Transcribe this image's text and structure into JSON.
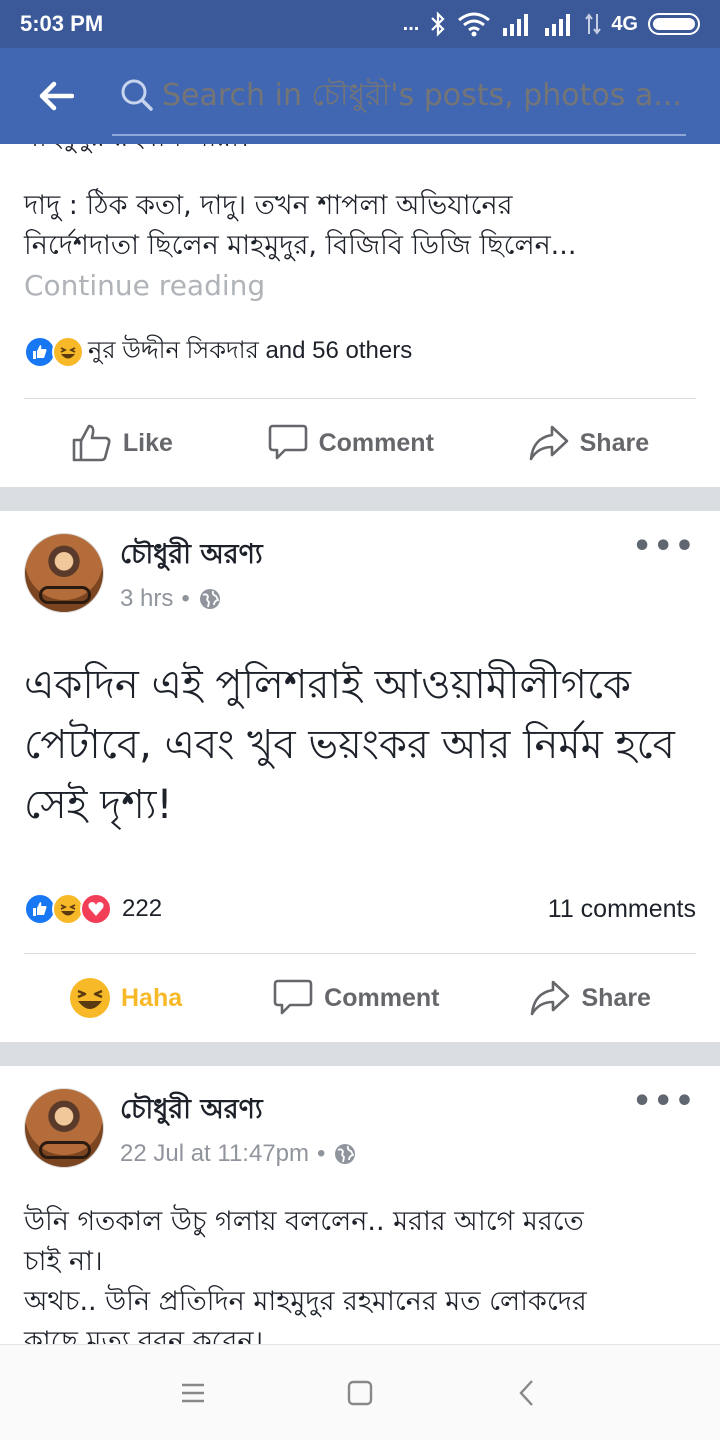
{
  "status_bar": {
    "time": "5:03 PM",
    "dots": "...",
    "network": "4G"
  },
  "app_bar": {
    "search_placeholder": "Search in চৌধুরী's posts, photos a..."
  },
  "post_prev": {
    "cut_line": "মাহমুদুর রহমান পারা।",
    "text_lines": [
      "দাদু : ঠিক কতা, দাদু। তখন শাপলা অভিযানের",
      "নির্দেশদাতা ছিলেন মাহমুদুর, বিজিবি ডিজি ছিলেন..."
    ],
    "continue_label": "Continue reading",
    "reactions_text": "নুর উদ্দীন সিকদার and 56 others",
    "actions": {
      "like": "Like",
      "comment": "Comment",
      "share": "Share"
    }
  },
  "post_main": {
    "author": "চৌধুরী অরণ্য",
    "time": "3 hrs",
    "text": "একদিন এই পুলিশরাই আওয়ামীলীগকে পেটাবে, এবং খুব ভয়ংকর আর নির্মম হবে সেই দৃশ্য!",
    "reaction_count": "222",
    "comments": "11 comments",
    "actions": {
      "haha": "Haha",
      "comment": "Comment",
      "share": "Share"
    }
  },
  "post_next": {
    "author": "চৌধুরী অরণ্য",
    "time": "22 Jul at 11:47pm",
    "text_lines": [
      "উনি গতকাল উচু গলায় বললেন.. মরার আগে মরতে",
      "চাই না।",
      "অথচ.. উনি প্রতিদিন মাহমুদুর রহমানের মত লোকদের",
      "কাছে মৃত্যু বরন করেন।"
    ]
  },
  "colors": {
    "status_bar": "#3b5998",
    "app_bar": "#4267b2",
    "like_blue": "#1877f2",
    "haha_yellow": "#f7b928",
    "love_red": "#f33e58"
  }
}
